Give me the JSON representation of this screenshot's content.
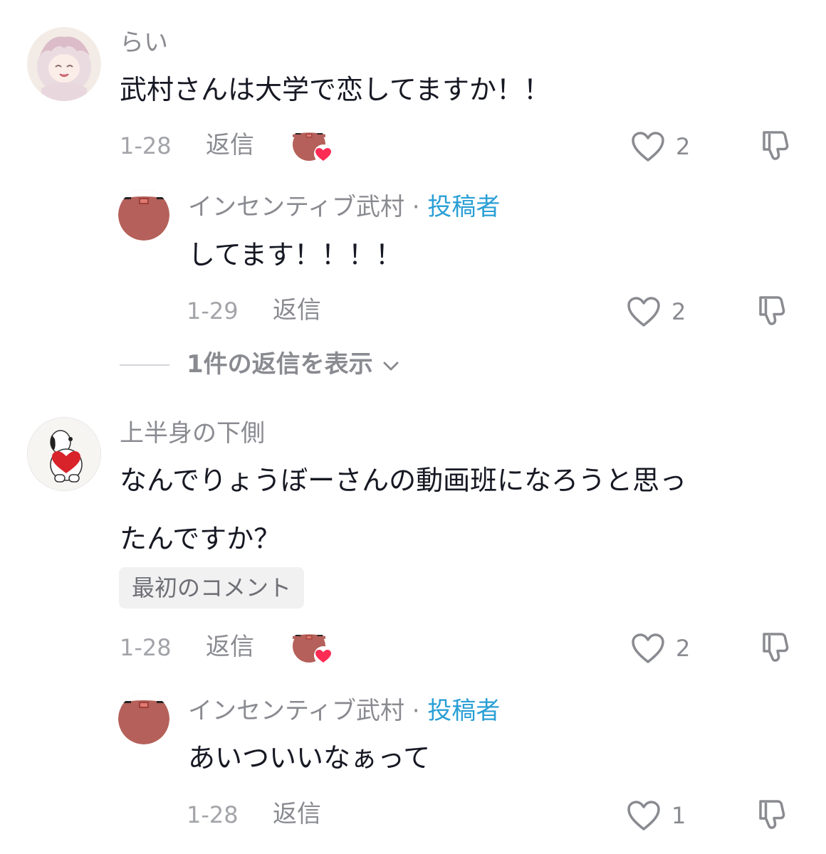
{
  "colors": {
    "creator_tag": "#2a9fd6",
    "heart_badge": "#fe2c55",
    "text_primary": "#161823",
    "text_secondary": "#8a8b91"
  },
  "comments": [
    {
      "username": "らい",
      "text": "武村さんは大学で恋してますか！！",
      "date": "1-28",
      "reply_label": "返信",
      "likes": "2",
      "creator_liked": true,
      "avatar_icon": "anime-girl-avatar",
      "replies": [
        {
          "username": "インセンティブ武村",
          "separator": "·",
          "creator_tag": "投稿者",
          "text": "してます！！！！",
          "date": "1-29",
          "reply_label": "返信",
          "likes": "2"
        }
      ],
      "view_replies": "1件の返信を表示"
    },
    {
      "username": "上半身の下側",
      "text_line1": "なんでりょうぼーさんの動画班になろうと思っ",
      "text_line2": "たんですか？",
      "badge": "最初のコメント",
      "date": "1-28",
      "reply_label": "返信",
      "likes": "2",
      "creator_liked": true,
      "avatar_icon": "snoopy-heart-avatar",
      "replies": [
        {
          "username": "インセンティブ武村",
          "separator": "·",
          "creator_tag": "投稿者",
          "text": "あいついいなぁって",
          "date": "1-28",
          "reply_label": "返信",
          "likes": "1"
        }
      ]
    }
  ]
}
